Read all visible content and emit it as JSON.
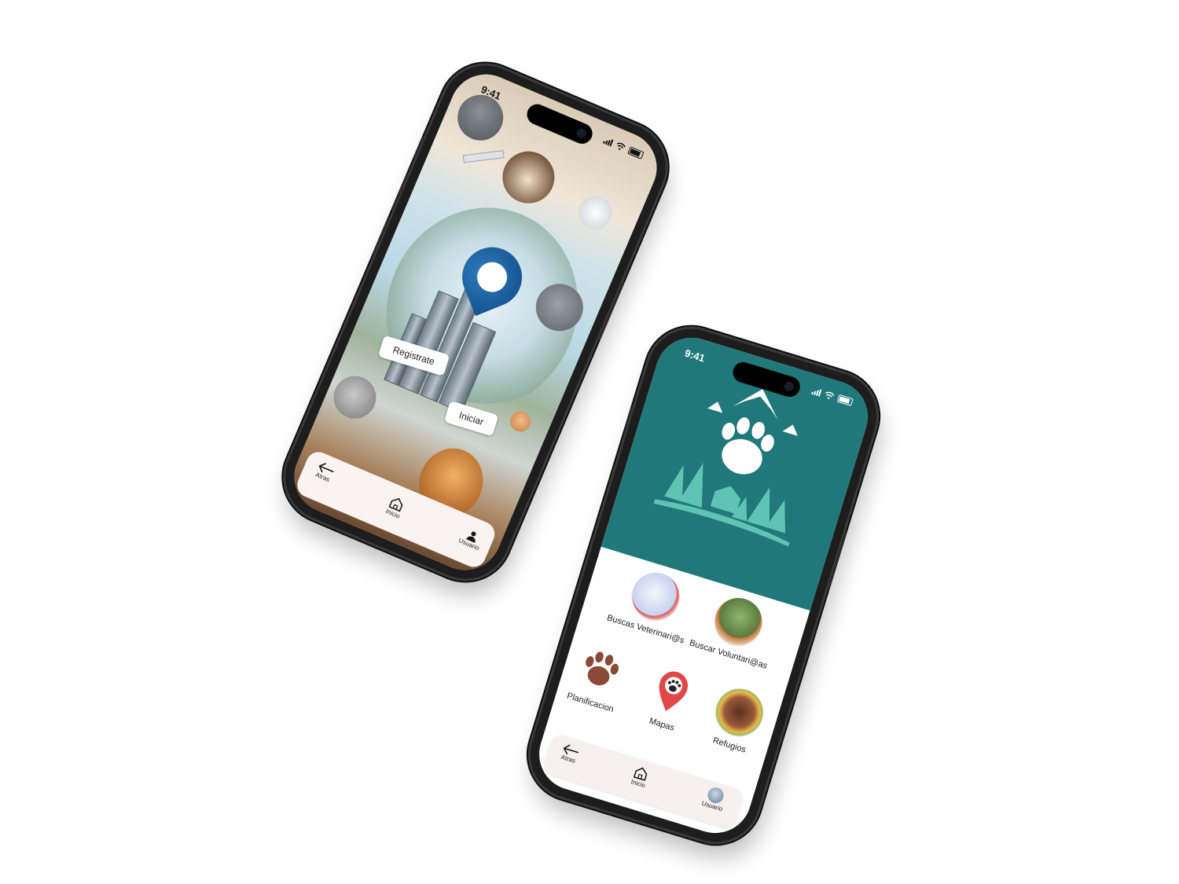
{
  "status_bar": {
    "time": "9:41"
  },
  "login_screen": {
    "register_button": "Registrate",
    "login_button": "Iniciar"
  },
  "home_screen": {
    "menu": [
      {
        "label": "Buscas Veterinari@s",
        "icon": "veterinarian-illustration-icon"
      },
      {
        "label": "Buscar Voluntari@as",
        "icon": "volunteer-illustration-icon"
      },
      {
        "label": "Planificacion",
        "icon": "paw-print-icon"
      },
      {
        "label": "Mapas",
        "icon": "map-pin-paw-icon"
      },
      {
        "label": "Refugios",
        "icon": "shelter-dog-illustration-icon"
      }
    ]
  },
  "bottom_nav": {
    "back": "Atras",
    "home": "Inicio",
    "user": "Usuario"
  },
  "colors": {
    "teal_header": "#20787a",
    "logo_mint": "#5fc4b3",
    "map_pin_blue": "#0f4a86",
    "nav_bg": "#f7eff0"
  }
}
